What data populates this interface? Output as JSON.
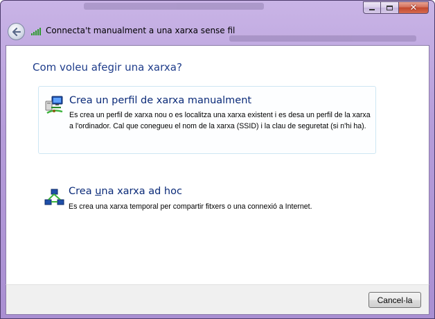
{
  "window": {
    "title": "Connecta't manualment a una xarxa sense fil"
  },
  "main": {
    "heading": "Com voleu afegir una xarxa?",
    "options": [
      {
        "title": "Crea un perfil de xarxa manualment",
        "description": "Es crea un perfil de xarxa nou o es localitza una xarxa existent i es desa un perfil de la xarxa a l'ordinador. Cal que conegueu el nom de la xarxa (SSID) i la clau de seguretat (si n'hi ha).",
        "icon": "network-computer-icon"
      },
      {
        "title_before": "Crea ",
        "title_accesskey": "u",
        "title_after": "na xarxa ad hoc",
        "description": "Es crea una xarxa temporal per compartir fitxers o una connexió a Internet.",
        "icon": "adhoc-network-icon"
      }
    ]
  },
  "footer": {
    "cancel_label": "Cancel·la"
  },
  "icons": {
    "back": "back-arrow-icon",
    "signal": "wifi-signal-icon",
    "minimize": "minimize-icon",
    "maximize": "maximize-icon",
    "close": "close-icon"
  },
  "colors": {
    "heading": "#1e3c8a",
    "option_title": "#0a2a78",
    "frame": "#b59cd9",
    "close_button": "#c2482e"
  }
}
